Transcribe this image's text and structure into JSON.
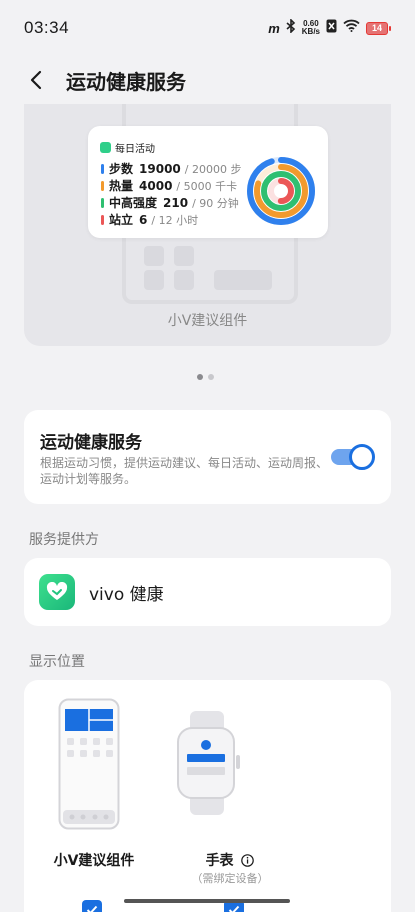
{
  "status_bar": {
    "time": "03:34",
    "speed_top": "0.60",
    "speed_bottom": "KB/s",
    "battery": "14",
    "battery_color": "#e53935"
  },
  "header": {
    "title": "运动健康服务",
    "back_icon": "chevron-left-icon"
  },
  "preview": {
    "caption": "小V建议组件",
    "widget": {
      "title": "每日活动",
      "metrics": [
        {
          "label": "步数",
          "value": "19000",
          "target": "/ 20000 步",
          "color": "#2f80ed",
          "progress": 0.95
        },
        {
          "label": "热量",
          "value": "4000",
          "target": "/ 5000 千卡",
          "color": "#f29a2e",
          "progress": 0.8
        },
        {
          "label": "中高强度",
          "value": "210",
          "target": "/ 90 分钟",
          "color": "#2fbf71",
          "progress": 1.0
        },
        {
          "label": "站立",
          "value": "6",
          "target": "/ 12 小时",
          "color": "#eb5757",
          "progress": 0.5
        }
      ]
    },
    "pager": {
      "count": 2,
      "active": 0
    }
  },
  "service": {
    "title": "运动健康服务",
    "description": "根据运动习惯，提供运动建议、每日活动、运动周报、运动计划等服务。",
    "enabled": true
  },
  "provider_section": {
    "label": "服务提供方",
    "name": "vivo 健康",
    "icon": "heart-app-icon"
  },
  "display_section": {
    "label": "显示位置",
    "options": [
      {
        "label": "小V建议组件",
        "sub": "",
        "checked": true
      },
      {
        "label": "手表",
        "sub": "（需绑定设备）",
        "checked": true,
        "info_icon": "info-icon"
      }
    ]
  },
  "accent_color": "#1a6fe0"
}
